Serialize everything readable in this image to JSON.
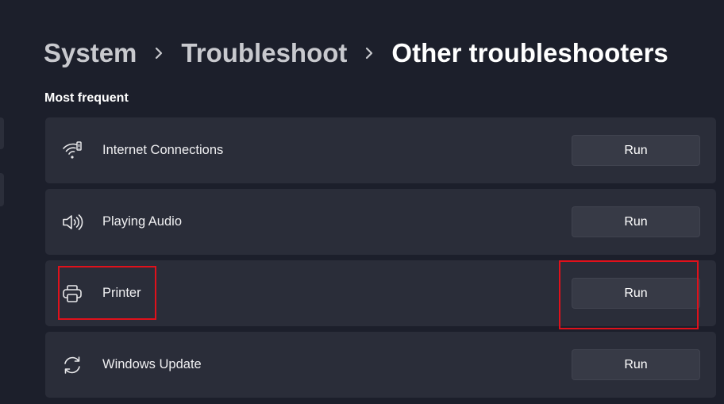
{
  "breadcrumb": {
    "items": [
      "System",
      "Troubleshoot"
    ],
    "current": "Other troubleshooters"
  },
  "section": {
    "title": "Most frequent"
  },
  "troubleshooters": [
    {
      "label": "Internet Connections",
      "icon": "wifi-icon",
      "button": "Run"
    },
    {
      "label": "Playing Audio",
      "icon": "speaker-icon",
      "button": "Run"
    },
    {
      "label": "Printer",
      "icon": "printer-icon",
      "button": "Run"
    },
    {
      "label": "Windows Update",
      "icon": "refresh-icon",
      "button": "Run"
    }
  ],
  "colors": {
    "background": "#1c1f2b",
    "card": "#2a2d39",
    "button": "#373a46",
    "highlight": "#e0111b"
  }
}
